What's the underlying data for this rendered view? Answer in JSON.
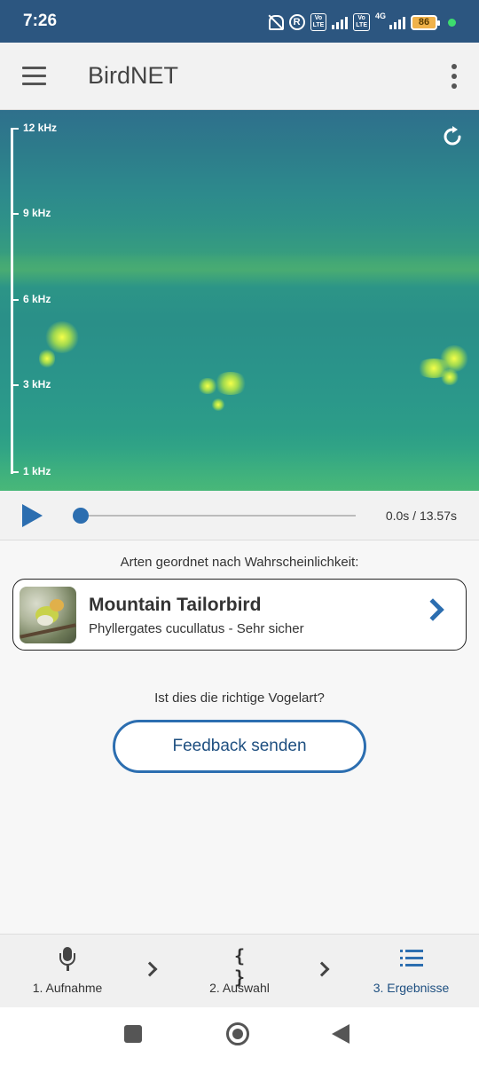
{
  "status_bar": {
    "time": "7:26",
    "battery": "86",
    "network": "4G"
  },
  "app_bar": {
    "title": "BirdNET"
  },
  "spectrogram": {
    "axis_labels": [
      "12 kHz",
      "9 kHz",
      "6 kHz",
      "3 kHz",
      "1 kHz"
    ]
  },
  "player": {
    "time": "0.0s / 13.57s",
    "progress": 0.0
  },
  "results": {
    "heading": "Arten geordnet nach Wahrscheinlichkeit:",
    "items": [
      {
        "name": "Mountain Tailorbird",
        "subtitle": "Phyllergates cucullatus - Sehr sicher"
      }
    ]
  },
  "feedback": {
    "question": "Ist dies die richtige Vogelart?",
    "button_label": "Feedback senden"
  },
  "bottom_nav": {
    "items": [
      {
        "label": "1. Aufnahme",
        "icon": "mic-icon"
      },
      {
        "label": "2. Auswahl",
        "icon": "braces-icon"
      },
      {
        "label": "3. Ergebnisse",
        "icon": "list-icon",
        "active": true
      }
    ]
  },
  "colors": {
    "status_bar": "#2c5680",
    "accent": "#2c6eb0",
    "battery": "#f0b24a"
  }
}
